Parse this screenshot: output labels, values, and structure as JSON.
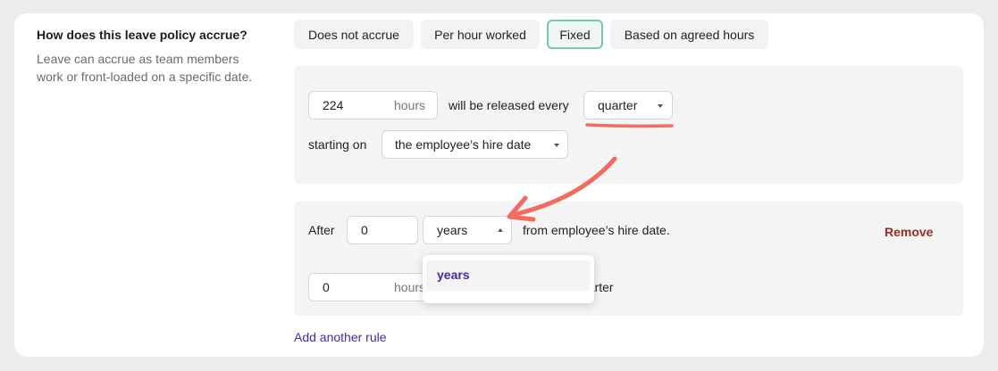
{
  "section": {
    "title": "How does this leave policy accrue?",
    "description": "Leave can accrue as team members work or front-loaded on a specific date."
  },
  "accrual_options": [
    {
      "label": "Does not accrue",
      "selected": false
    },
    {
      "label": "Per hour worked",
      "selected": false
    },
    {
      "label": "Fixed",
      "selected": true
    },
    {
      "label": "Based on agreed hours",
      "selected": false
    }
  ],
  "fixed_rule": {
    "hours_value": "224",
    "hours_unit": "hours",
    "released_text": "will be released every",
    "period_value": "quarter",
    "starting_text": "starting on",
    "start_value": "the employee’s hire date"
  },
  "rule2": {
    "after_text": "After",
    "after_value": "0",
    "unit_value": "years",
    "from_text": "from employee’s hire date.",
    "remove_label": "Remove",
    "hours_value": "0",
    "hours_unit": "hours",
    "period_partial": "uarter"
  },
  "dropdown": {
    "options": [
      "years"
    ]
  },
  "add_rule_label": "Add another rule",
  "colors": {
    "accent_selected_border": "#7cc4b4",
    "link": "#3d2ea8",
    "remove": "#9b2c1f",
    "annotation": "#f26b5e"
  }
}
